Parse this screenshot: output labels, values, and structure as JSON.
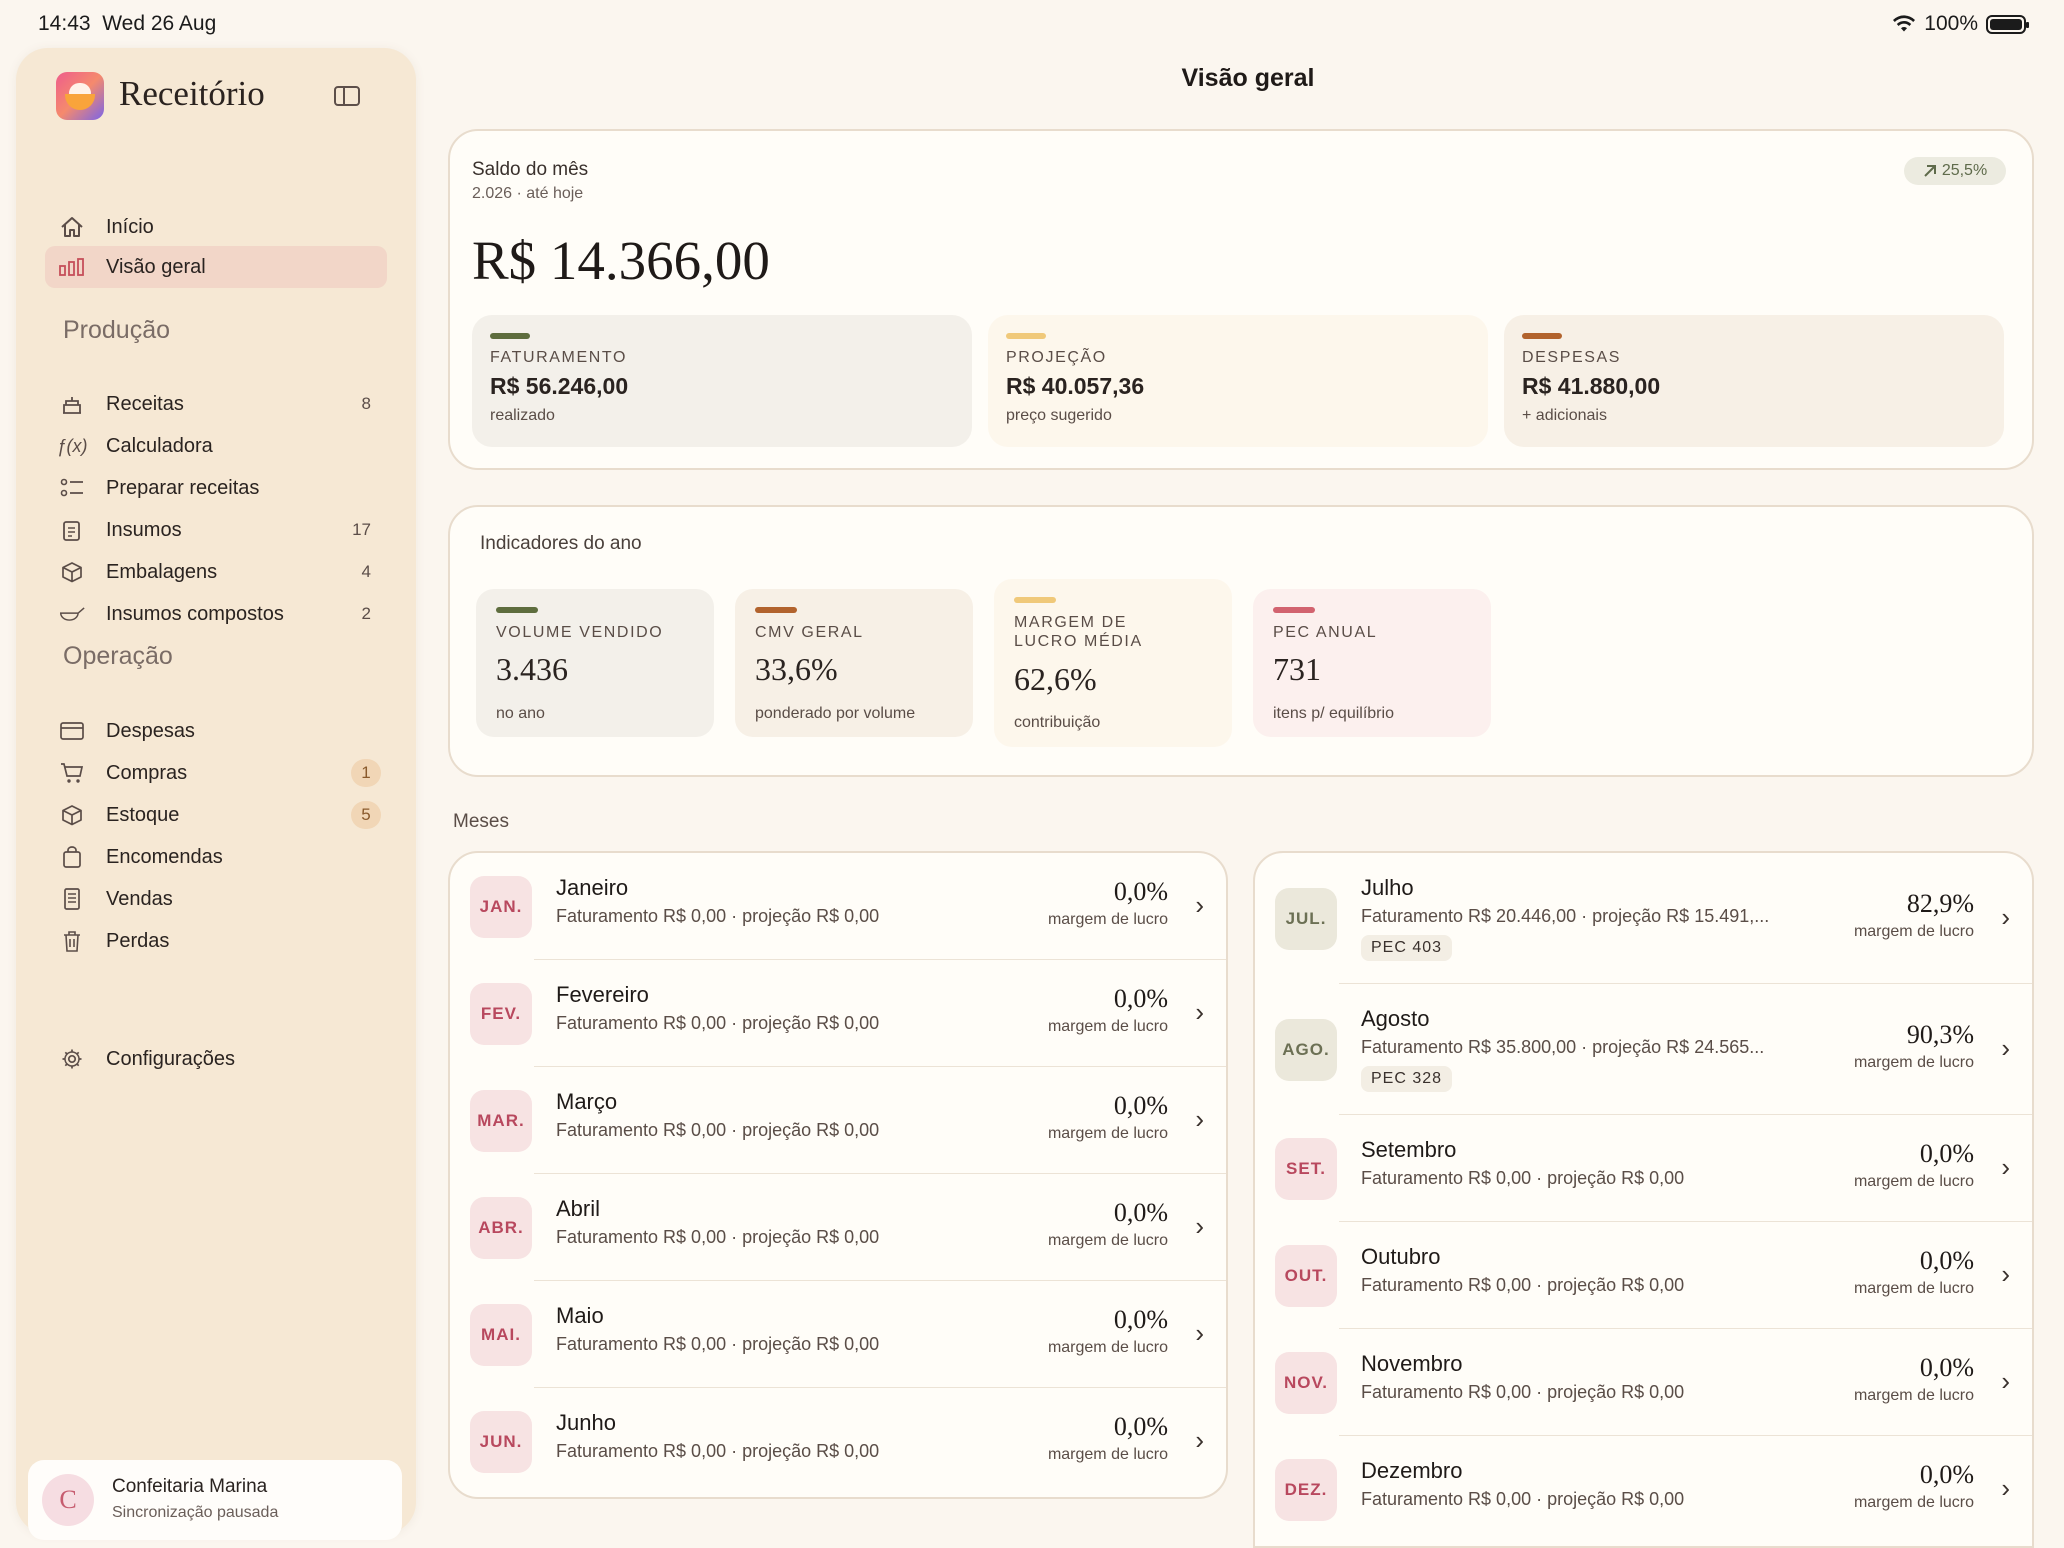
{
  "status": {
    "time": "14:43",
    "date": "Wed 26 Aug",
    "battery": "100%"
  },
  "app": {
    "title": "Receitório"
  },
  "nav": {
    "top": [
      {
        "label": "Início",
        "icon": "home-icon"
      },
      {
        "label": "Visão geral",
        "icon": "bar-chart-icon",
        "active": true
      }
    ],
    "producao_title": "Produção",
    "producao": [
      {
        "label": "Receitas",
        "icon": "cake-icon",
        "count": "8"
      },
      {
        "label": "Calculadora",
        "icon": "function-icon",
        "count": ""
      },
      {
        "label": "Preparar receitas",
        "icon": "checklist-icon",
        "count": ""
      },
      {
        "label": "Insumos",
        "icon": "clipboard-icon",
        "count": "17"
      },
      {
        "label": "Embalagens",
        "icon": "box-icon",
        "count": "4"
      },
      {
        "label": "Insumos compostos",
        "icon": "bowl-icon",
        "count": "2"
      }
    ],
    "operacao_title": "Operação",
    "operacao": [
      {
        "label": "Despesas",
        "icon": "card-icon",
        "badge": ""
      },
      {
        "label": "Compras",
        "icon": "cart-icon",
        "badge": "1"
      },
      {
        "label": "Estoque",
        "icon": "box-icon",
        "badge": "5"
      },
      {
        "label": "Encomendas",
        "icon": "bag-icon",
        "badge": ""
      },
      {
        "label": "Vendas",
        "icon": "receipt-icon",
        "badge": ""
      },
      {
        "label": "Perdas",
        "icon": "trash-icon",
        "badge": ""
      }
    ],
    "settings": "Configurações"
  },
  "account": {
    "initial": "C",
    "name": "Confeitaria Marina",
    "status": "Sincronização pausada"
  },
  "page": {
    "title": "Visão geral"
  },
  "saldo": {
    "label": "Saldo do mês",
    "sub": "2.026 · até hoje",
    "value": "R$ 14.366,00",
    "trend": "25,5%",
    "kpis": [
      {
        "key": "FATURAMENTO",
        "value": "R$ 56.246,00",
        "sub": "realizado",
        "color": "#5e6d3e",
        "bg": "#f3f0ea"
      },
      {
        "key": "PROJEÇÃO",
        "value": "R$ 40.057,36",
        "sub": "preço sugerido",
        "color": "#f0c97a",
        "bg": "#fdf7ec"
      },
      {
        "key": "DESPESAS",
        "value": "R$ 41.880,00",
        "sub": "+ adicionais",
        "color": "#b2632d",
        "bg": "#f7f0e6"
      }
    ]
  },
  "indicadores": {
    "title": "Indicadores do ano",
    "items": [
      {
        "key": "VOLUME VENDIDO",
        "value": "3.436",
        "sub": "no ano",
        "color": "#5e6d3e",
        "bg": "#f3f0ea"
      },
      {
        "key": "CMV GERAL",
        "value": "33,6%",
        "sub": "ponderado por volume",
        "color": "#b2632d",
        "bg": "#f7f0e6"
      },
      {
        "key": "MARGEM DE LUCRO MÉDIA",
        "value": "62,6%",
        "sub": "contribuição",
        "color": "#f0c97a",
        "bg": "#fdf7ec"
      },
      {
        "key": "PEC ANUAL",
        "value": "731",
        "sub": "itens p/ equilíbrio",
        "color": "#d2636f",
        "bg": "#fcf0ee"
      }
    ]
  },
  "meses": {
    "label": "Meses",
    "margin_label": "margem de lucro",
    "left": [
      {
        "abbr": "JAN.",
        "name": "Janeiro",
        "detail": "Faturamento R$ 0,00 · projeção R$ 0,00",
        "pct": "0,0%",
        "tone": "pink",
        "pec": ""
      },
      {
        "abbr": "FEV.",
        "name": "Fevereiro",
        "detail": "Faturamento R$ 0,00 · projeção R$ 0,00",
        "pct": "0,0%",
        "tone": "pink",
        "pec": ""
      },
      {
        "abbr": "MAR.",
        "name": "Março",
        "detail": "Faturamento R$ 0,00 · projeção R$ 0,00",
        "pct": "0,0%",
        "tone": "pink",
        "pec": ""
      },
      {
        "abbr": "ABR.",
        "name": "Abril",
        "detail": "Faturamento R$ 0,00 · projeção R$ 0,00",
        "pct": "0,0%",
        "tone": "pink",
        "pec": ""
      },
      {
        "abbr": "MAI.",
        "name": "Maio",
        "detail": "Faturamento R$ 0,00 · projeção R$ 0,00",
        "pct": "0,0%",
        "tone": "pink",
        "pec": ""
      },
      {
        "abbr": "JUN.",
        "name": "Junho",
        "detail": "Faturamento R$ 0,00 · projeção R$ 0,00",
        "pct": "0,0%",
        "tone": "pink",
        "pec": ""
      }
    ],
    "right": [
      {
        "abbr": "JUL.",
        "name": "Julho",
        "detail": "Faturamento R$ 20.446,00 · projeção R$ 15.491,...",
        "pct": "82,9%",
        "tone": "olive",
        "pec": "PEC 403"
      },
      {
        "abbr": "AGO.",
        "name": "Agosto",
        "detail": "Faturamento R$ 35.800,00 · projeção R$ 24.565...",
        "pct": "90,3%",
        "tone": "olive",
        "pec": "PEC 328"
      },
      {
        "abbr": "SET.",
        "name": "Setembro",
        "detail": "Faturamento R$ 0,00 · projeção R$ 0,00",
        "pct": "0,0%",
        "tone": "pink",
        "pec": ""
      },
      {
        "abbr": "OUT.",
        "name": "Outubro",
        "detail": "Faturamento R$ 0,00 · projeção R$ 0,00",
        "pct": "0,0%",
        "tone": "pink",
        "pec": ""
      },
      {
        "abbr": "NOV.",
        "name": "Novembro",
        "detail": "Faturamento R$ 0,00 · projeção R$ 0,00",
        "pct": "0,0%",
        "tone": "pink",
        "pec": ""
      },
      {
        "abbr": "DEZ.",
        "name": "Dezembro",
        "detail": "Faturamento R$ 0,00 · projeção R$ 0,00",
        "pct": "0,0%",
        "tone": "pink",
        "pec": ""
      }
    ]
  }
}
